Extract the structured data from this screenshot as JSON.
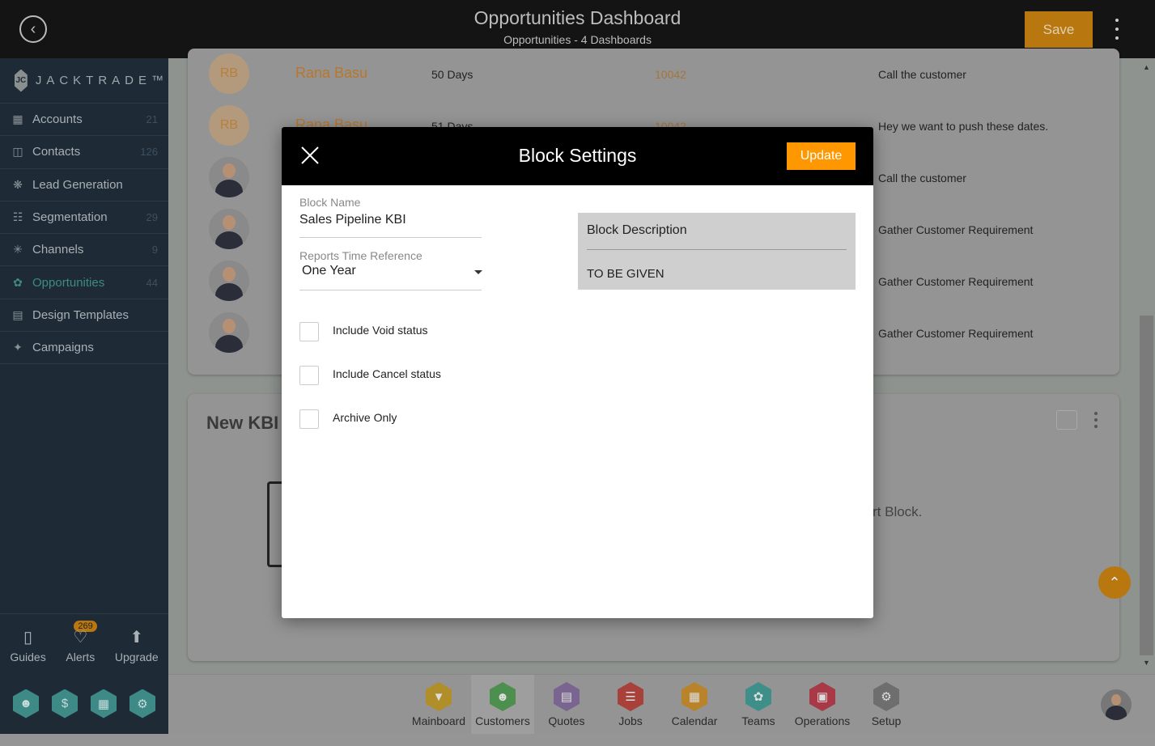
{
  "header": {
    "title": "Opportunities Dashboard",
    "subtitle": "Opportunities - 4 Dashboards",
    "save_label": "Save",
    "back_icon": "arrow-left-circle-icon"
  },
  "sidebar": {
    "logo": "JACKTRADE™",
    "items": [
      {
        "label": "Accounts",
        "count": "21",
        "icon": "building-icon"
      },
      {
        "label": "Contacts",
        "count": "126",
        "icon": "contacts-icon"
      },
      {
        "label": "Lead Generation",
        "count": "",
        "icon": "lead-icon"
      },
      {
        "label": "Segmentation",
        "count": "29",
        "icon": "segmentation-icon"
      },
      {
        "label": "Channels",
        "count": "9",
        "icon": "channels-icon"
      },
      {
        "label": "Opportunities",
        "count": "44",
        "icon": "opportunities-icon",
        "active": true
      },
      {
        "label": "Design Templates",
        "count": "",
        "icon": "template-icon"
      },
      {
        "label": "Campaigns",
        "count": "",
        "icon": "campaign-icon"
      }
    ],
    "bottom": [
      {
        "label": "Guides"
      },
      {
        "label": "Alerts",
        "badge": "269"
      },
      {
        "label": "Upgrade"
      }
    ]
  },
  "rows": [
    {
      "initials": "RB",
      "name": "Rana Basu",
      "days": "50 Days",
      "id": "10042",
      "note": "Call the customer"
    },
    {
      "initials": "RB",
      "name": "Rana Basu",
      "days": "51 Days",
      "id": "10042",
      "note": "Hey we want to push these dates."
    },
    {
      "initials": "",
      "note": "Call the customer"
    },
    {
      "initials": "",
      "note": "Gather Customer Requirement"
    },
    {
      "initials": "",
      "note": "Gather Customer Requirement"
    },
    {
      "initials": "",
      "note": "Gather Customer Requirement"
    }
  ],
  "kbi": {
    "title": "New KBI",
    "empty_text": "rt Block."
  },
  "apps": [
    {
      "label": "Mainboard",
      "color": "#b08e2a"
    },
    {
      "label": "Customers",
      "color": "#4d8f4e",
      "selected": true
    },
    {
      "label": "Quotes",
      "color": "#7a6590"
    },
    {
      "label": "Jobs",
      "color": "#a8413a"
    },
    {
      "label": "Calendar",
      "color": "#b8832a"
    },
    {
      "label": "Teams",
      "color": "#3e8f8a"
    },
    {
      "label": "Operations",
      "color": "#a83a48"
    },
    {
      "label": "Setup",
      "color": "#6e6e6e"
    }
  ],
  "modal": {
    "title": "Block Settings",
    "update_label": "Update",
    "block_name_label": "Block Name",
    "block_name_value": "Sales Pipeline KBI",
    "time_ref_label": "Reports Time Reference",
    "time_ref_value": "One Year",
    "description_label": "Block Description",
    "description_value": "TO BE GIVEN",
    "checkboxes": [
      {
        "label": "Include Void status",
        "checked": false
      },
      {
        "label": "Include Cancel status",
        "checked": false
      },
      {
        "label": "Archive Only",
        "checked": false
      }
    ]
  }
}
